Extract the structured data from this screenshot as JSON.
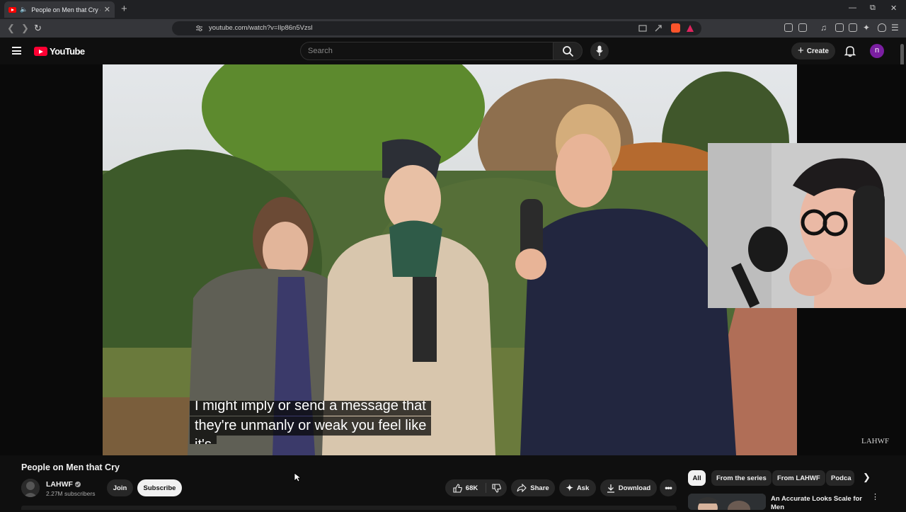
{
  "browser": {
    "tab_title": "People on Men that Cry - You",
    "url": "youtube.com/watch?v=Ilp86n5Vzsl"
  },
  "masthead": {
    "logo_text": "YouTube",
    "search_placeholder": "Search",
    "create_label": "Create",
    "avatar_letter": "n"
  },
  "player": {
    "caption_lines": [
      "I might imply or send a message that",
      "they're unmanly or weak you feel like",
      "it's"
    ],
    "watermark": "LAHWF"
  },
  "video": {
    "title": "People on Men that Cry",
    "channel_name": "LAHWF",
    "subscribers": "2.27M subscribers",
    "join_label": "Join",
    "subscribe_label": "Subscribe",
    "like_count": "68K",
    "share_label": "Share",
    "ask_label": "Ask",
    "download_label": "Download"
  },
  "sidebar": {
    "chips": [
      "All",
      "From the series",
      "From LAHWF",
      "Podca"
    ],
    "recommendation_title": "An Accurate Looks Scale for Men"
  },
  "colors": {
    "background": "#0f0f0f",
    "youtube_red": "#ff0033",
    "avatar_purple": "#7b1fa2",
    "pill_dark": "#272727"
  }
}
